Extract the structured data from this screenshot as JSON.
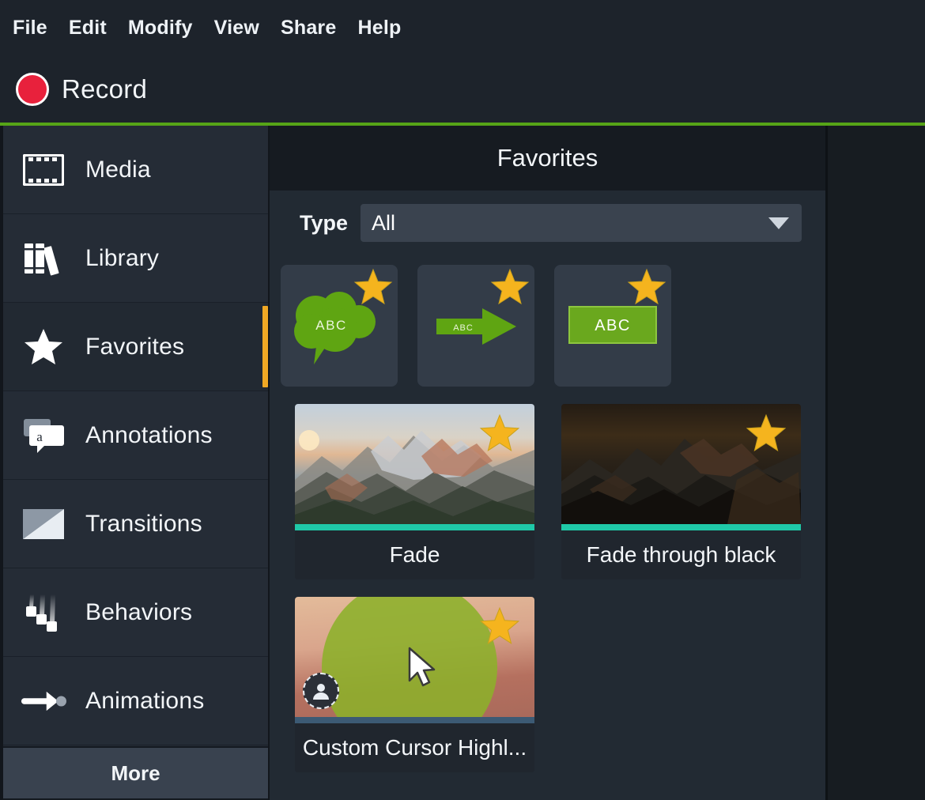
{
  "app": {
    "accent_green": "#56a417",
    "accent_orange": "#f0a824",
    "record_red": "#e8213c"
  },
  "menubar": {
    "items": [
      {
        "label": "File"
      },
      {
        "label": "Edit"
      },
      {
        "label": "Modify"
      },
      {
        "label": "View"
      },
      {
        "label": "Share"
      },
      {
        "label": "Help"
      }
    ]
  },
  "toolbar": {
    "record_label": "Record",
    "record_icon": "record-circle-icon"
  },
  "sidebar": {
    "items": [
      {
        "label": "Media",
        "icon": "film-strip-icon",
        "selected": false
      },
      {
        "label": "Library",
        "icon": "books-icon",
        "selected": false
      },
      {
        "label": "Favorites",
        "icon": "star-icon",
        "selected": true
      },
      {
        "label": "Annotations",
        "icon": "speech-bubble-a-icon",
        "selected": false
      },
      {
        "label": "Transitions",
        "icon": "gradient-square-icon",
        "selected": false
      },
      {
        "label": "Behaviors",
        "icon": "motion-squares-icon",
        "selected": false
      },
      {
        "label": "Animations",
        "icon": "arrow-dot-icon",
        "selected": false
      }
    ],
    "more_label": "More"
  },
  "panel": {
    "title": "Favorites",
    "filter": {
      "label": "Type",
      "value": "All",
      "caret_icon": "chevron-down-icon"
    },
    "annotation_tiles": [
      {
        "name": "callout-cloud",
        "text": "ABC",
        "favorited": true,
        "star_icon": "star-icon"
      },
      {
        "name": "arrow-annotation",
        "text": "ABC",
        "favorited": true,
        "star_icon": "star-icon"
      },
      {
        "name": "rectangle-annotation",
        "text": "ABC",
        "favorited": true,
        "star_icon": "star-icon"
      }
    ],
    "cards": [
      {
        "caption": "Fade",
        "accent": "#1fc9a8",
        "favorited": true,
        "star_icon": "star-icon",
        "thumb": "mountain-light"
      },
      {
        "caption": "Fade through black",
        "accent": "#1fc9a8",
        "favorited": true,
        "star_icon": "star-icon",
        "thumb": "mountain-dark"
      },
      {
        "caption": "Custom Cursor Highl...",
        "accent": "#3c5a74",
        "favorited": true,
        "star_icon": "star-icon",
        "thumb": "cursor-highlight",
        "badge_icon": "person-icon",
        "cursor_icon": "mouse-pointer-icon"
      }
    ]
  }
}
